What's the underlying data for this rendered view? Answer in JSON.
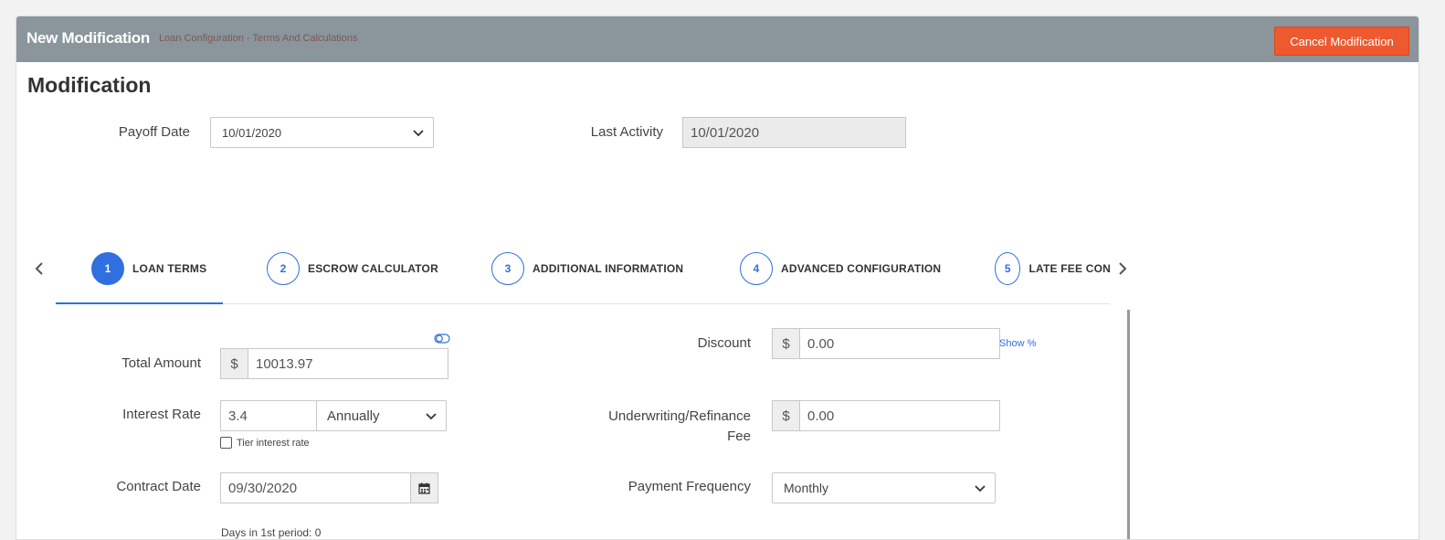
{
  "header": {
    "title": "New Modification",
    "subtitle": "Loan Configuration - Terms And Calculations",
    "cancel_label": "Cancel Modification"
  },
  "section_title": "Modification",
  "payoff": {
    "label": "Payoff Date",
    "value": "10/01/2020"
  },
  "last_activity": {
    "label": "Last Activity",
    "value": "10/01/2020"
  },
  "steps": [
    {
      "num": "1",
      "label": "LOAN TERMS",
      "active": true
    },
    {
      "num": "2",
      "label": "ESCROW CALCULATOR",
      "active": false
    },
    {
      "num": "3",
      "label": "ADDITIONAL INFORMATION",
      "active": false
    },
    {
      "num": "4",
      "label": "ADVANCED CONFIGURATION",
      "active": false
    },
    {
      "num": "5",
      "label": "LATE FEE CON",
      "active": false
    }
  ],
  "form": {
    "total_amount": {
      "label": "Total Amount",
      "currency": "$",
      "value": "10013.97"
    },
    "interest_rate": {
      "label": "Interest Rate",
      "value": "3.4",
      "period": "Annually",
      "tier_label": "Tier interest rate",
      "tier_checked": false
    },
    "contract_date": {
      "label": "Contract Date",
      "value": "09/30/2020"
    },
    "days_first_period": "Days in 1st period: 0",
    "discount": {
      "label": "Discount",
      "currency": "$",
      "value": "0.00",
      "show_pct": "Show %"
    },
    "underwriting_fee": {
      "label_line1": "Underwriting/Refinance",
      "label_line2": "Fee",
      "currency": "$",
      "value": "0.00"
    },
    "payment_frequency": {
      "label": "Payment Frequency",
      "value": "Monthly"
    }
  },
  "colors": {
    "header_bg": "#8a959c",
    "cancel_btn": "#ee5a2f",
    "accent": "#2f6fe0"
  },
  "icons": [
    "chevron-down-icon",
    "chevron-left-icon",
    "chevron-right-icon",
    "calendar-icon",
    "toggle-icon"
  ]
}
